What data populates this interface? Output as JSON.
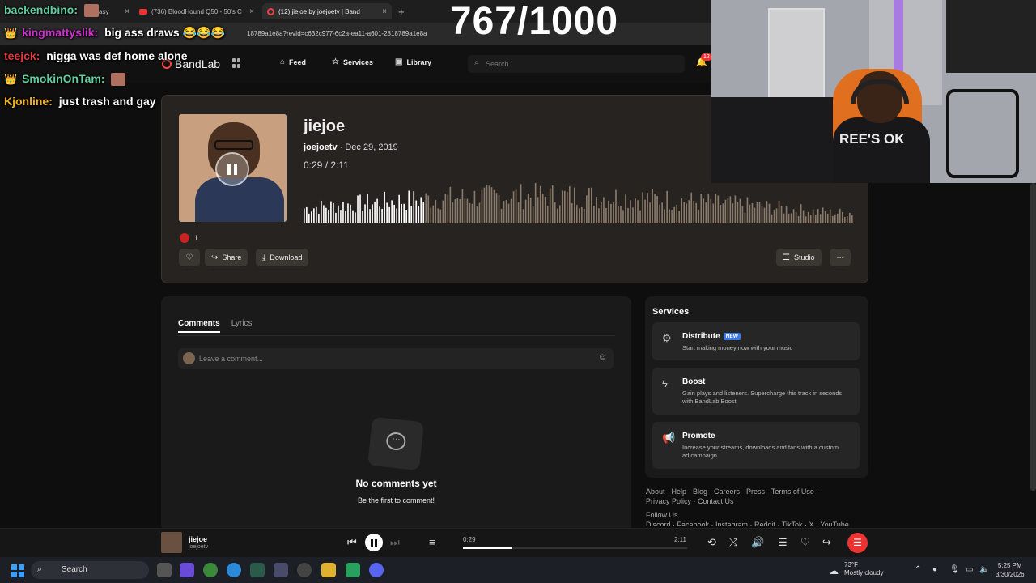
{
  "browser": {
    "tabs": [
      {
        "title": "Fantasy",
        "close": "×"
      },
      {
        "title": "(736) BloodHound Q50 - 50's C",
        "close": "×"
      },
      {
        "title": "(12) jiejoe by joejoetv | Band",
        "close": "×"
      }
    ],
    "new_tab": "+",
    "url": "18789a1e8a?revId=c632c977-6c2a-ea11-a601-2818789a1e8a"
  },
  "stream": {
    "counter": "767/1000",
    "chat": [
      {
        "user": "backendbino:",
        "user_color": "#5fd0a0",
        "message": "",
        "crown": false
      },
      {
        "user": "kingmattyslik:",
        "user_color": "#d030d0",
        "message": "big ass draws",
        "crown": true,
        "laugh": "😂😂😂"
      },
      {
        "user": "teejck:",
        "user_color": "#e03a3a",
        "message": "nigga was def home alone",
        "crown": false
      },
      {
        "user": "SmokinOnTam:",
        "user_color": "#5fd0a0",
        "message": "",
        "crown": true
      },
      {
        "user": "Kjonline:",
        "user_color": "#f0b020",
        "message": "just trash and gay",
        "crown": false
      }
    ],
    "crown_icon": "👑",
    "webcam_text": "REE'S OK"
  },
  "nav": {
    "logo": "BandLab",
    "feed": "Feed",
    "services": "Services",
    "library": "Library",
    "search_placeholder": "Search",
    "notif_count": "12"
  },
  "track": {
    "title": "jiejoe",
    "artist": "joejoetv",
    "date": "· Dec 29, 2019",
    "current": "0:29",
    "separator": "/",
    "duration": "2:11",
    "progress": 0.221,
    "reactions": "1",
    "share": "Share",
    "download": "Download",
    "studio": "Studio",
    "more": "···"
  },
  "comments": {
    "tab_comments": "Comments",
    "tab_lyrics": "Lyrics",
    "placeholder": "Leave a comment...",
    "empty_title": "No comments yet",
    "empty_sub": "Be the first to comment!"
  },
  "services": {
    "heading": "Services",
    "items": [
      {
        "title": "Distribute",
        "badge": "NEW",
        "desc": "Start making money now with your music"
      },
      {
        "title": "Boost",
        "badge": "",
        "desc": "Gain plays and listeners. Supercharge this track in seconds with BandLab Boost"
      },
      {
        "title": "Promote",
        "badge": "",
        "desc": "Increase your streams, downloads and fans with a custom ad campaign"
      }
    ]
  },
  "footer": {
    "links1": "About · Help · Blog · Careers · Press · Terms of Use ·",
    "links2": "Privacy Policy · Contact Us",
    "follow": "Follow Us",
    "social": "Discord · Facebook · Instagram · Reddit · TikTok · X · YouTube"
  },
  "bottom_player": {
    "title": "jiejoe",
    "artist": "joejoetv",
    "current": "0:29",
    "duration": "2:11",
    "progress": 0.221
  },
  "taskbar": {
    "search": "Search",
    "temp": "73°F",
    "weather": "Mostly cloudy",
    "time": "5:25 PM",
    "date": "3/30/2026"
  },
  "colors": {
    "accent": "#e33333",
    "wave_played": "#ffffff",
    "wave_unplayed": "#8a7a6a"
  }
}
